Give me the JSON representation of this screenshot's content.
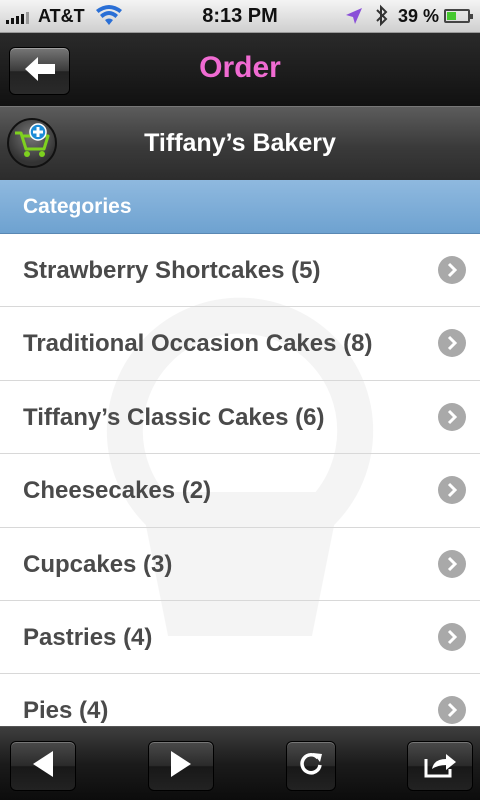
{
  "status_bar": {
    "carrier": "AT&T",
    "time": "8:13 PM",
    "battery_percent": "39 %",
    "battery_level": 0.39,
    "icons": [
      "signal-icon",
      "wifi-icon",
      "location-icon",
      "bluetooth-icon",
      "battery-icon"
    ]
  },
  "nav": {
    "title": "Order",
    "title_color": "#f06bd2",
    "back_icon": "arrow-left-icon"
  },
  "store": {
    "name": "Tiffany’s Bakery",
    "cart_icon": "cart-add-icon"
  },
  "categories": {
    "header": "Categories",
    "header_color": "#7eaed9",
    "items": [
      {
        "label": "Strawberry Shortcakes (5)"
      },
      {
        "label": "Traditional Occasion Cakes (8)"
      },
      {
        "label": "Tiffany’s Classic Cakes (6)"
      },
      {
        "label": "Cheesecakes (2)"
      },
      {
        "label": "Cupcakes (3)"
      },
      {
        "label": "Pastries (4)"
      },
      {
        "label": "Pies (4)"
      }
    ]
  },
  "toolbar": {
    "buttons": [
      "back-arrow-icon",
      "forward-arrow-icon",
      "refresh-icon",
      "share-icon"
    ]
  }
}
